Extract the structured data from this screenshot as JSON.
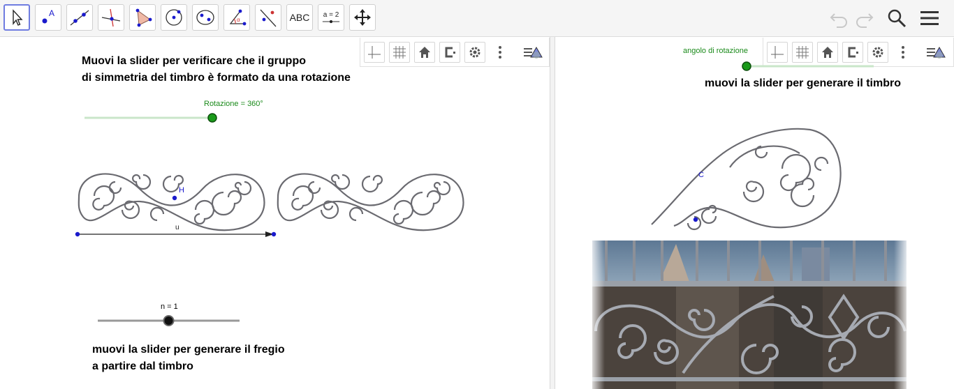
{
  "toolbar": {
    "tools": [
      {
        "name": "move-tool"
      },
      {
        "name": "point-tool",
        "glyph": "A"
      },
      {
        "name": "line-tool"
      },
      {
        "name": "perpendicular-line-tool"
      },
      {
        "name": "polygon-tool"
      },
      {
        "name": "circle-tool"
      },
      {
        "name": "ellipse-tool"
      },
      {
        "name": "angle-tool",
        "glyph": "α"
      },
      {
        "name": "reflect-tool"
      },
      {
        "name": "text-tool",
        "label": "ABC"
      },
      {
        "name": "slider-tool",
        "label": "a = 2"
      },
      {
        "name": "move-graphics-tool"
      }
    ],
    "right": [
      "undo-icon",
      "redo-icon",
      "search-icon",
      "menu-icon"
    ]
  },
  "left_panel": {
    "instruction_line1": "Muovi la slider per verificare che il gruppo",
    "instruction_line2": "di simmetria del timbro  è formato da una rotazione",
    "rotation_slider": {
      "label": "Rotazione = 360°",
      "value_deg": 360,
      "fraction": 1.0,
      "color": "#1a8a1a"
    },
    "n_slider": {
      "label": "n = 1",
      "value": 1,
      "fraction": 0.5
    },
    "point_label_H": "H",
    "vector_label_u": "u",
    "bottom_line1": "muovi la slider per generare il fregio",
    "bottom_line2": "a partire dal timbro"
  },
  "right_panel": {
    "angle_slider_label": "angolo di rotazione",
    "angle_slider_fraction": 0.0,
    "instruction": "muovi la slider per generare il timbro",
    "point_label_C": "C"
  },
  "graphics_toolbar": {
    "buttons": [
      "axes-icon",
      "grid-icon",
      "home-icon",
      "point-capture-icon",
      "settings-icon",
      "more-icon",
      "style-bar-icon"
    ]
  },
  "colors": {
    "accent": "#6f7ce0",
    "slider_green": "#1a8a1a",
    "point_blue": "#1a1acc",
    "ironwork": "#6a6a70"
  }
}
